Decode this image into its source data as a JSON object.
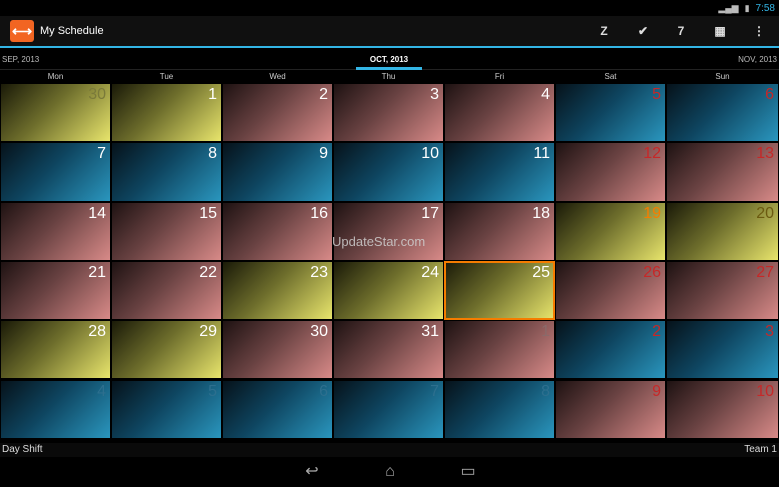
{
  "status_bar": {
    "time": "7:58",
    "icons": [
      "signal-icon",
      "battery-icon"
    ]
  },
  "action_bar": {
    "logo_glyph": "⟷",
    "title": "My Schedule",
    "actions": [
      {
        "name": "shift-z-icon",
        "glyph": "Z"
      },
      {
        "name": "check-icon",
        "glyph": "✔"
      },
      {
        "name": "shift-7-icon",
        "glyph": "7"
      },
      {
        "name": "pattern-icon",
        "glyph": "▦"
      },
      {
        "name": "overflow-menu-icon",
        "glyph": "⋮"
      }
    ]
  },
  "month_nav": {
    "prev": "SEP, 2013",
    "current": "OCT, 2013",
    "next": "NOV, 2013"
  },
  "weekdays": [
    "Mon",
    "Tue",
    "Wed",
    "Thu",
    "Fri",
    "Sat",
    "Sun"
  ],
  "days": [
    {
      "n": "30",
      "t": "yellow",
      "c": "#7a7a3a"
    },
    {
      "n": "1",
      "t": "yellow",
      "c": "#ffffff"
    },
    {
      "n": "2",
      "t": "pink",
      "c": "#ffffff"
    },
    {
      "n": "3",
      "t": "pink",
      "c": "#ffffff"
    },
    {
      "n": "4",
      "t": "pink",
      "c": "#ffffff"
    },
    {
      "n": "5",
      "t": "blue",
      "c": "#c62828"
    },
    {
      "n": "6",
      "t": "blue",
      "c": "#c62828"
    },
    {
      "n": "7",
      "t": "blue",
      "c": "#ffffff"
    },
    {
      "n": "8",
      "t": "blue",
      "c": "#ffffff"
    },
    {
      "n": "9",
      "t": "blue",
      "c": "#ffffff"
    },
    {
      "n": "10",
      "t": "blue",
      "c": "#ffffff"
    },
    {
      "n": "11",
      "t": "blue",
      "c": "#ffffff"
    },
    {
      "n": "12",
      "t": "pink",
      "c": "#c62828"
    },
    {
      "n": "13",
      "t": "pink",
      "c": "#c62828"
    },
    {
      "n": "14",
      "t": "pink",
      "c": "#ffffff"
    },
    {
      "n": "15",
      "t": "pink",
      "c": "#ffffff"
    },
    {
      "n": "16",
      "t": "pink",
      "c": "#ffffff"
    },
    {
      "n": "17",
      "t": "pink",
      "c": "#ffffff"
    },
    {
      "n": "18",
      "t": "pink",
      "c": "#ffffff"
    },
    {
      "n": "19",
      "t": "yellow",
      "c": "#f57c00"
    },
    {
      "n": "20",
      "t": "yellow",
      "c": "#6b5a10"
    },
    {
      "n": "21",
      "t": "pink",
      "c": "#ffffff"
    },
    {
      "n": "22",
      "t": "pink",
      "c": "#ffffff"
    },
    {
      "n": "23",
      "t": "yellow",
      "c": "#ffffff"
    },
    {
      "n": "24",
      "t": "yellow",
      "c": "#ffffff"
    },
    {
      "n": "25",
      "t": "yellow",
      "c": "#ffffff",
      "today": true
    },
    {
      "n": "26",
      "t": "pink",
      "c": "#c62828"
    },
    {
      "n": "27",
      "t": "pink",
      "c": "#c62828"
    },
    {
      "n": "28",
      "t": "yellow",
      "c": "#ffffff"
    },
    {
      "n": "29",
      "t": "yellow",
      "c": "#ffffff"
    },
    {
      "n": "30",
      "t": "pink",
      "c": "#ffffff"
    },
    {
      "n": "31",
      "t": "pink",
      "c": "#ffffff"
    },
    {
      "n": "1",
      "t": "pink",
      "c": "#8a6a6a"
    },
    {
      "n": "2",
      "t": "blue",
      "c": "#c62828"
    },
    {
      "n": "3",
      "t": "blue",
      "c": "#c62828"
    },
    {
      "n": "4",
      "t": "blue",
      "c": "#2d6f8e"
    },
    {
      "n": "5",
      "t": "blue",
      "c": "#2d6f8e"
    },
    {
      "n": "6",
      "t": "blue",
      "c": "#2d6f8e"
    },
    {
      "n": "7",
      "t": "blue",
      "c": "#2d6f8e"
    },
    {
      "n": "8",
      "t": "blue",
      "c": "#2d6f8e"
    },
    {
      "n": "9",
      "t": "pink",
      "c": "#c62828"
    },
    {
      "n": "10",
      "t": "pink",
      "c": "#c62828"
    }
  ],
  "watermark": "UpdateStar.com",
  "footer": {
    "shift": "Day Shift",
    "team": "Team 1"
  },
  "nav_bar": [
    {
      "name": "back-icon",
      "glyph": "↩"
    },
    {
      "name": "home-icon",
      "glyph": "⌂"
    },
    {
      "name": "recents-icon",
      "glyph": "▭"
    }
  ]
}
